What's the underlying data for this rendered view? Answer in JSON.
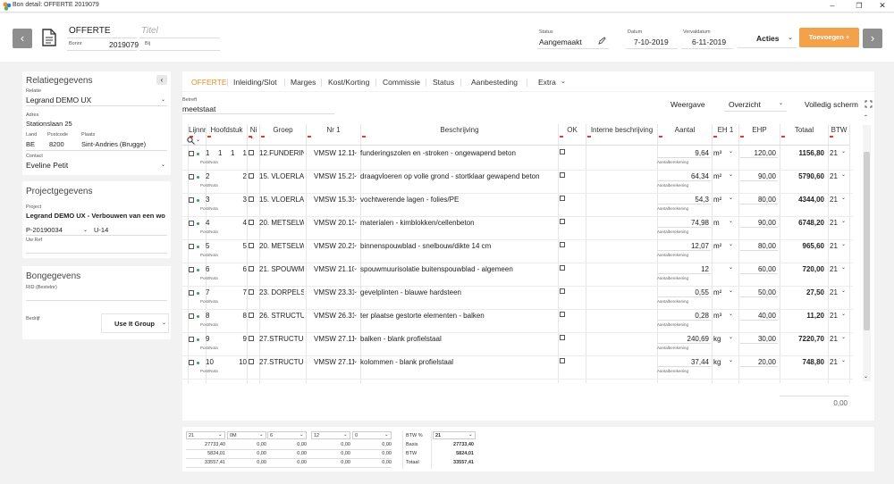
{
  "window": {
    "title": "Bon detail: OFFERTE 2019079",
    "minimize": "–",
    "maximize": "❐",
    "close": "✕"
  },
  "header": {
    "doc_type": "OFFERTE",
    "title_placeholder": "Titel",
    "bonnr_label": "Bonnr",
    "bonnr": "2019079",
    "bij_label": "Bij",
    "status_label": "Status",
    "status": "Aangemaakt",
    "datum_label": "Datum",
    "datum": "7-10-2019",
    "vervaldatum_label": "Vervaldatum",
    "vervaldatum": "6-11-2019",
    "acties_label": "Acties",
    "toevoegen_label": "Toevoegen +",
    "prev_icon": "‹",
    "next_icon": "›"
  },
  "relatie": {
    "title": "Relatiegegevens",
    "badge": "‹",
    "relatie_label": "Relatie",
    "relatie": "Legrand DEMO UX",
    "adres_label": "Adres",
    "adres": "Stationslaan 25",
    "land_label": "Land",
    "land": "BE",
    "postcode_label": "Postcode",
    "postcode": "8200",
    "plaats_label": "Plaats",
    "plaats": "Sint-Andries (Brugge)",
    "contact_label": "Contact",
    "contact": "Eveline Petit"
  },
  "project": {
    "title": "Projectgegevens",
    "project_label": "Project",
    "project": "Legrand DEMO UX - Verbouwen van een wo",
    "code": "P-20190034",
    "unit": "U-14",
    "uwref_label": "Uw Ref"
  },
  "bon": {
    "title": "Bongegevens",
    "rid_label": "RID (Bestelnr)",
    "bedrijf_label": "Bedrijf",
    "bedrijf": "Use It Group"
  },
  "tabs": [
    "OFFERTE",
    "Inleiding/Slot",
    "Marges",
    "Kost/Korting",
    "Commissie",
    "Status",
    "Aanbesteding",
    "Extra"
  ],
  "grid": {
    "betreft_label": "Betreft",
    "betreft": "meetstaat",
    "weergave_label": "Weergave",
    "weergave": "Overzicht",
    "fullscreen_label": "Volledig scherm",
    "columns": [
      "Lijnnr",
      "Hoofdstuk",
      "Ni",
      "Groep",
      "Nr 1",
      "Beschrijving",
      "OK",
      "Interne beschrijving",
      "Aantal",
      "EH 1",
      "EHP",
      "Totaal",
      "BTW"
    ],
    "sub_postnota": "Post/Nota",
    "sub_aantal": "Aantalberekening",
    "rows": [
      {
        "lijn": "1",
        "hs": "1",
        "h2": "1",
        "ni": "1",
        "groep": "12.FUNDERIN",
        "nr": "VMSW 12.11.",
        "besch": "funderingszolen en -stroken - ongewapend beton",
        "aantal": "9,64",
        "eh": "m³",
        "ehp": "120,00",
        "totaal": "1156,80",
        "btw": "21"
      },
      {
        "lijn": "2",
        "ni": "2",
        "groep": "15. VLOERLAG",
        "nr": "VMSW 15.21.",
        "besch": "draagvloeren op volle grond - stortklaar gewapend beton",
        "aantal": "64,34",
        "eh": "m²",
        "ehp": "90,00",
        "totaal": "5790,60",
        "btw": "21"
      },
      {
        "lijn": "3",
        "ni": "3",
        "groep": "15. VLOERLAG",
        "nr": "VMSW 15.31.",
        "besch": "vochtwerende lagen - folies/PE",
        "aantal": "54,3",
        "eh": "m²",
        "ehp": "80,00",
        "totaal": "4344,00",
        "btw": "21"
      },
      {
        "lijn": "4",
        "ni": "4",
        "groep": "20. METSELW",
        "nr": "VMSW 20.13",
        "besch": "materialen - kimblokken/cellenbeton",
        "aantal": "74,98",
        "eh": "m",
        "ehp": "90,00",
        "totaal": "6748,20",
        "btw": "21"
      },
      {
        "lijn": "5",
        "ni": "5",
        "groep": "20. METSELW",
        "nr": "VMSW 20.21",
        "besch": "binnenspouwblad - snelbouw/dikte 14 cm",
        "aantal": "12,07",
        "eh": "m²",
        "ehp": "80,00",
        "totaal": "965,60",
        "btw": "21"
      },
      {
        "lijn": "6",
        "ni": "6",
        "groep": "21. SPOUWMU",
        "nr": "VMSW 21.10.",
        "besch": "spouwmuurisolatie buitenspouwblad - algemeen",
        "aantal": "12",
        "eh": "",
        "ehp": "60,00",
        "totaal": "720,00",
        "btw": "21"
      },
      {
        "lijn": "7",
        "ni": "7",
        "groep": "23. DORPELS,",
        "nr": "VMSW 23.31.",
        "besch": "gevelplinten - blauwe hardsteen",
        "aantal": "0,55",
        "eh": "m²",
        "ehp": "50,00",
        "totaal": "27,50",
        "btw": "21"
      },
      {
        "lijn": "8",
        "ni": "8",
        "groep": "26. STRUCTUU",
        "nr": "VMSW 26.31.",
        "besch": "ter plaatse gestorte elementen - balken",
        "aantal": "0,28",
        "eh": "m³",
        "ehp": "40,00",
        "totaal": "11,20",
        "btw": "21"
      },
      {
        "lijn": "9",
        "ni": "9",
        "groep": "27.STRUCTUU",
        "nr": "VMSW 27.11.",
        "besch": "balken - blank profielstaal",
        "aantal": "240,69",
        "eh": "kg",
        "ehp": "30,00",
        "totaal": "7220,70",
        "btw": "21"
      },
      {
        "lijn": "10",
        "ni": "10",
        "groep": "27.STRUCTUU",
        "nr": "VMSW 27.11.",
        "besch": "kolommen - blank profielstaal",
        "aantal": "37,44",
        "eh": "kg",
        "ehp": "20,00",
        "totaal": "748,80",
        "btw": "21"
      }
    ],
    "footer_total": "0,00"
  },
  "summary": {
    "headers": [
      "21",
      "0M",
      "6",
      "12",
      "0"
    ],
    "rows": [
      [
        "27733,40",
        "0,00",
        "0,00",
        "0,00",
        "0,00"
      ],
      [
        "5824,01",
        "0,00",
        "0,00",
        "0,00",
        "0,00"
      ],
      [
        "33557,41",
        "0,00",
        "0,00",
        "0,00",
        "0,00"
      ]
    ],
    "btw_label": "BTW %",
    "btw_value": "21",
    "labels": [
      "Basis",
      "BTW",
      "Totaal"
    ],
    "values": [
      "27733,40",
      "5824,01",
      "33557,41"
    ]
  }
}
